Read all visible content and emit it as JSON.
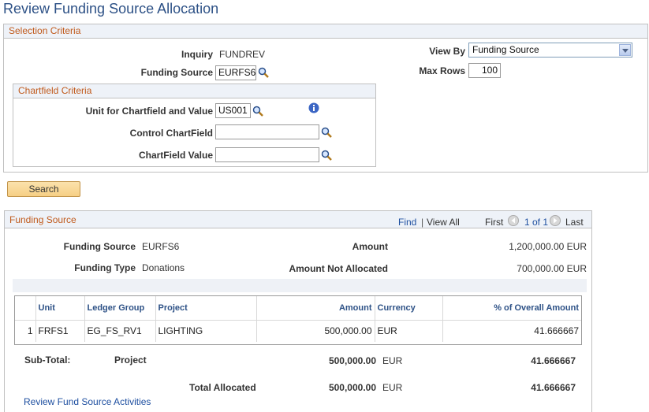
{
  "page_title": "Review Funding Source Allocation",
  "selection": {
    "header": "Selection Criteria",
    "inquiry_label": "Inquiry",
    "inquiry_value": "FUNDREV",
    "funding_source_label": "Funding Source",
    "funding_source_value": "EURFS6",
    "view_by_label": "View By",
    "view_by_value": "Funding Source",
    "max_rows_label": "Max Rows",
    "max_rows_value": "100"
  },
  "chartfield": {
    "header": "Chartfield Criteria",
    "unit_label": "Unit for Chartfield and Value",
    "unit_value": "US001",
    "control_label": "Control ChartField",
    "control_value": "",
    "value_label": "ChartField Value",
    "value_value": ""
  },
  "search_button": "Search",
  "funding": {
    "header": "Funding Source",
    "find": "Find",
    "view_all": "View All",
    "first": "First",
    "pager": "1 of 1",
    "last": "Last",
    "funding_source_label": "Funding Source",
    "funding_source_value": "EURFS6",
    "funding_type_label": "Funding Type",
    "funding_type_value": "Donations",
    "amount_label": "Amount",
    "amount_value": "1,200,000.00 EUR",
    "not_allocated_label": "Amount Not Allocated",
    "not_allocated_value": "700,000.00 EUR"
  },
  "grid": {
    "columns": [
      "Unit",
      "Ledger Group",
      "Project",
      "Amount",
      "Currency",
      "% of Overall Amount"
    ],
    "rows": [
      {
        "num": "1",
        "unit": "FRFS1",
        "ledger_group": "EG_FS_RV1",
        "project": "LIGHTING",
        "amount": "500,000.00",
        "currency": "EUR",
        "pct": "41.666667"
      }
    ]
  },
  "subtotal": {
    "label": "Sub-Total:",
    "by": "Project",
    "amount": "500,000.00",
    "currency": "EUR",
    "pct": "41.666667"
  },
  "total": {
    "label": "Total Allocated",
    "amount": "500,000.00",
    "currency": "EUR",
    "pct": "41.666667"
  },
  "review_link": "Review Fund Source Activities",
  "colors": {
    "title": "#2d5186",
    "section_header": "#c05a1c",
    "link": "#1e4fa0"
  }
}
